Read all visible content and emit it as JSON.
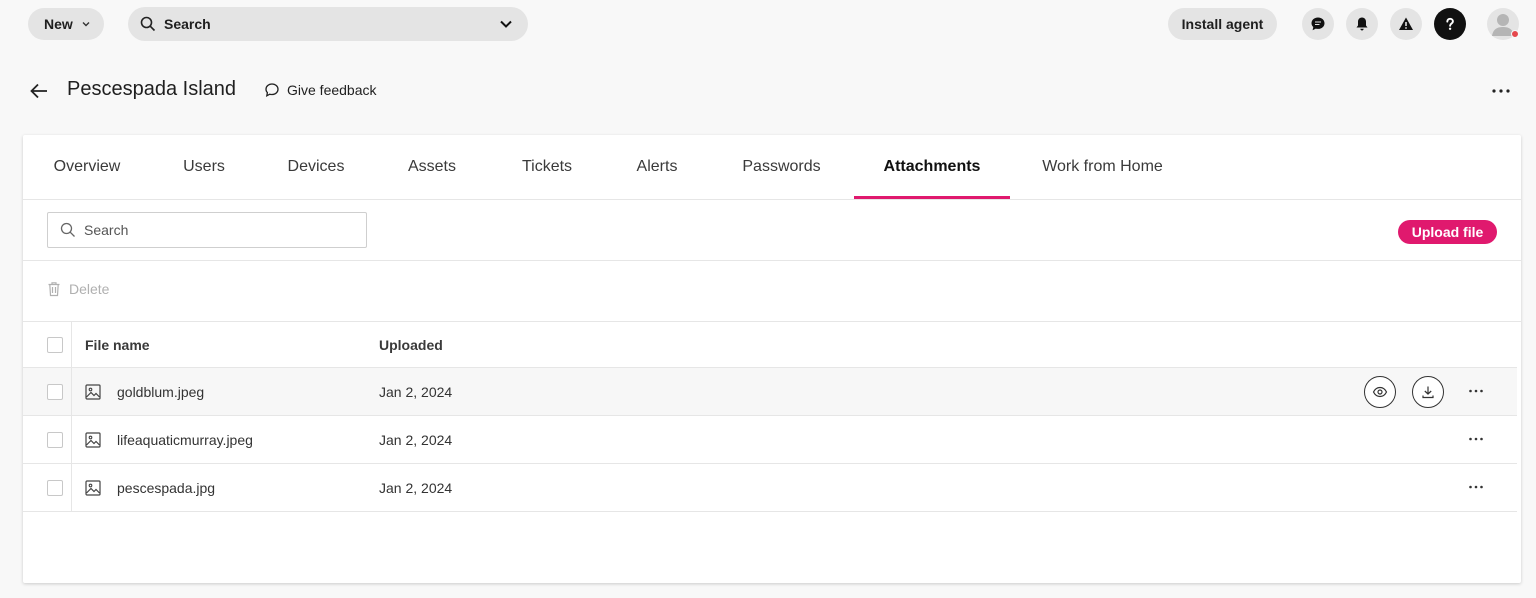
{
  "topbar": {
    "new_label": "New",
    "search_label": "Search",
    "install_label": "Install agent"
  },
  "header": {
    "title": "Pescespada Island",
    "feedback_label": "Give feedback"
  },
  "tabs": [
    {
      "label": "Overview"
    },
    {
      "label": "Users"
    },
    {
      "label": "Devices"
    },
    {
      "label": "Assets"
    },
    {
      "label": "Tickets"
    },
    {
      "label": "Alerts"
    },
    {
      "label": "Passwords"
    },
    {
      "label": "Attachments",
      "active": true
    },
    {
      "label": "Work from Home"
    }
  ],
  "attachments": {
    "search_placeholder": "Search",
    "upload_label": "Upload file",
    "delete_label": "Delete",
    "columns": {
      "file_name": "File name",
      "uploaded": "Uploaded"
    },
    "rows": [
      {
        "file_name": "goldblum.jpeg",
        "uploaded": "Jan 2, 2024"
      },
      {
        "file_name": "lifeaquaticmurray.jpeg",
        "uploaded": "Jan 2, 2024"
      },
      {
        "file_name": "pescespada.jpg",
        "uploaded": "Jan 2, 2024"
      }
    ]
  },
  "colors": {
    "accent": "#e0196e",
    "notification_dot": "#e5484d"
  }
}
